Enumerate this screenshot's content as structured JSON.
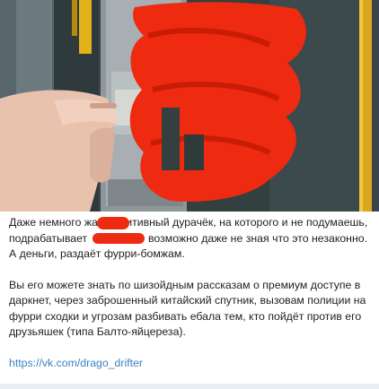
{
  "post": {
    "para1_part1": "Даже немного жалк",
    "para1_part2": "имитивный дурачёк, на которого и не подумаешь, подрабатывает",
    "para1_part3": "возможно даже не зная что это незаконно. А деньги, раздаёт фурри-бомжам.",
    "para2": "Вы его можете знать по шизойдным рассказам о премиум доступе в даркнет, через заброшенный китайский спутник, вызовам полиции на фурри сходки и угрозам разбивать ебала тем, кто пойдёт против его друзьяшек (типа Балто-яйцереза).",
    "link": "https://vk.com/drago_drifter"
  },
  "colors": {
    "redaction": "#ee2a10",
    "link": "#3a82c4",
    "text": "#1f1f1f"
  }
}
